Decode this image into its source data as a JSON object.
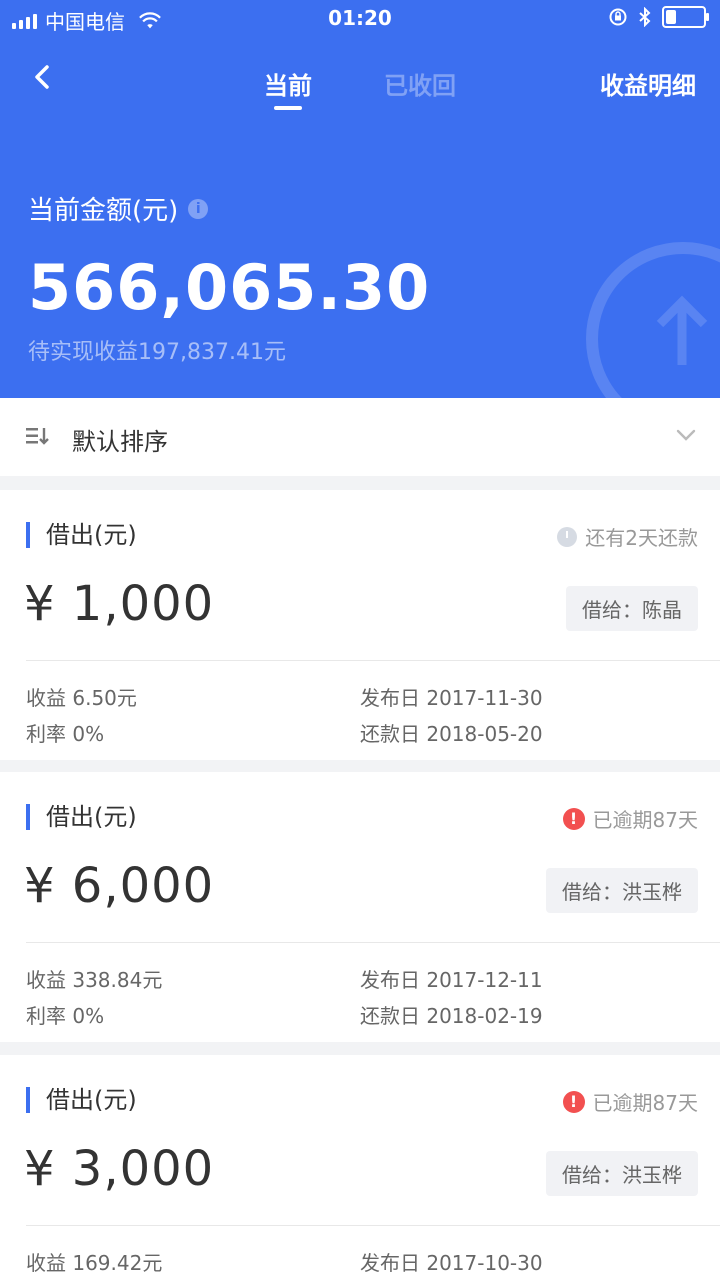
{
  "status_bar": {
    "carrier": "中国电信",
    "time": "01:20"
  },
  "nav": {
    "tabs": [
      {
        "label": "当前",
        "active": true
      },
      {
        "label": "已收回",
        "active": false
      }
    ],
    "detail_label": "收益明细"
  },
  "summary": {
    "label": "当前金额(元)",
    "amount": "566,065.30",
    "pending_text": "待实现收益197,837.41元"
  },
  "sort": {
    "label": "默认排序"
  },
  "colors": {
    "brand": "#3c6ff0",
    "alert": "#f25050"
  },
  "loans": [
    {
      "title": "借出(元)",
      "status_icon": "clock-icon",
      "status_text": "还有2天还款",
      "amount": "¥ 1,000",
      "borrower": "借给：陈晶",
      "income": "收益 6.50元",
      "rate": "利率 0%",
      "publish_date": "发布日 2017-11-30",
      "repay_date": "还款日 2018-05-20"
    },
    {
      "title": "借出(元)",
      "status_icon": "alert-icon",
      "status_text": "已逾期87天",
      "amount": "¥ 6,000",
      "borrower": "借给：洪玉桦",
      "income": "收益 338.84元",
      "rate": "利率 0%",
      "publish_date": "发布日 2017-12-11",
      "repay_date": "还款日 2018-02-19"
    },
    {
      "title": "借出(元)",
      "status_icon": "alert-icon",
      "status_text": "已逾期87天",
      "amount": "¥ 3,000",
      "borrower": "借给：洪玉桦",
      "income": "收益 169.42元",
      "publish_date": "发布日 2017-10-30"
    }
  ]
}
